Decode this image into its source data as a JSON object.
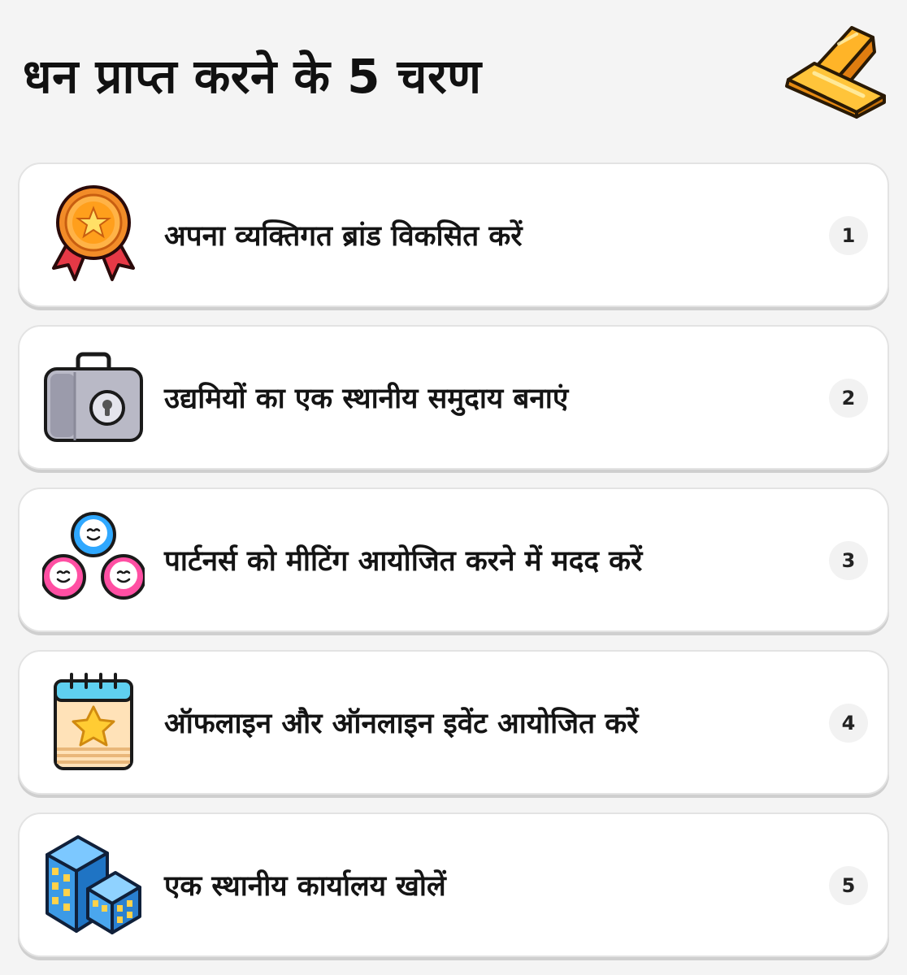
{
  "header": {
    "title": "धन प्राप्त करने के 5 चरण",
    "icon": "gold-bars-icon"
  },
  "steps": [
    {
      "label": "अपना व्यक्तिगत ब्रांड विकसित करें",
      "number": "1",
      "icon": "award-medal-icon"
    },
    {
      "label": "उद्यमियों का एक स्थानीय समुदाय बनाएं",
      "number": "2",
      "icon": "briefcase-lock-icon"
    },
    {
      "label": "पार्टनर्स को मीटिंग आयोजित करने में मदद करें",
      "number": "3",
      "icon": "people-group-icon"
    },
    {
      "label": "ऑफलाइन और ऑनलाइन इवेंट आयोजित करें",
      "number": "4",
      "icon": "calendar-star-icon"
    },
    {
      "label": "एक स्थानीय कार्यालय खोलें",
      "number": "5",
      "icon": "office-buildings-icon"
    }
  ],
  "colors": {
    "background": "#f4f4f4",
    "card": "#ffffff",
    "gold": "#f5a21b",
    "badge_bg": "#f2f2f2"
  }
}
